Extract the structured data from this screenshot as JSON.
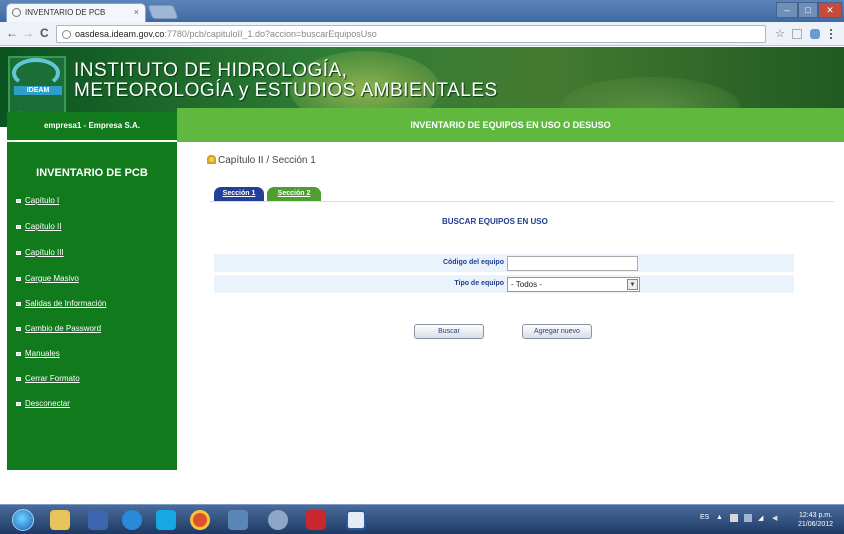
{
  "browser": {
    "tab_title": "INVENTARIO DE PCB",
    "tab_close": "×",
    "url_host": "oasdesa.ideam.gov.co",
    "url_path": ":7780/pcb/capituloII_1.do?accion=buscarEquiposUso",
    "back": "←",
    "forward": "→",
    "reload": "C",
    "star": "☆",
    "min": "–",
    "max": "□",
    "close": "✕"
  },
  "banner": {
    "line1": "INSTITUTO DE HIDROLOGÍA,",
    "line2": "METEOROLOGÍA y ESTUDIOS AMBIENTALES",
    "logo_text": "IDEAM",
    "logo_url": "www.ideam.gov.co"
  },
  "header": {
    "company": "empresa1 - Empresa S.A.",
    "title": "INVENTARIO DE EQUIPOS EN USO O DESUSO"
  },
  "sidebar": {
    "title": "INVENTARIO DE PCB",
    "items": [
      {
        "label": "Capítulo I"
      },
      {
        "label": "Capítulo II"
      },
      {
        "label": "Capítulo III"
      },
      {
        "label": "Cargue Masivo"
      },
      {
        "label": "Salidas de Información"
      },
      {
        "label": "Cambio de Password"
      },
      {
        "label": "Manuales"
      },
      {
        "label": "Cerrar Formato"
      },
      {
        "label": "Desconectar"
      }
    ]
  },
  "main": {
    "breadcrumb": "Capítulo II / Sección 1",
    "tabs": [
      {
        "label": "Sección 1",
        "color": "#243f9a"
      },
      {
        "label": "Sección 2",
        "color": "#4e9f2f"
      }
    ],
    "section_title": "BUSCAR EQUIPOS EN USO",
    "form": {
      "codigo_label": "Código del equipo",
      "codigo_value": "",
      "tipo_label": "Tipo de equipo",
      "tipo_value": "- Todos -"
    },
    "buttons": {
      "search": "Buscar",
      "add": "Agregar nuevo"
    }
  },
  "taskbar": {
    "language": "ES",
    "time": "12:43 p.m.",
    "date": "21/06/2012"
  },
  "colors": {
    "dark_green": "#117a1c",
    "light_green": "#60b93e",
    "title_blue": "#1f3d91"
  }
}
